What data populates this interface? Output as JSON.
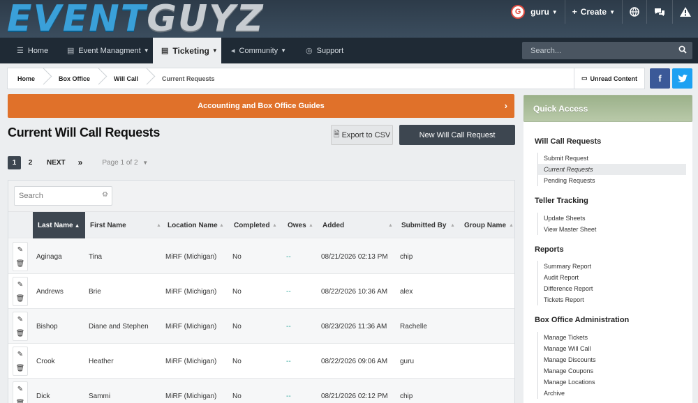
{
  "brand": {
    "logo_part1": "EVENT",
    "logo_part2": "GUYZ"
  },
  "user_bar": {
    "avatar_letter": "G",
    "username": "guru",
    "create_label": "Create"
  },
  "nav": {
    "items": [
      {
        "label": "Home"
      },
      {
        "label": "Event Managment"
      },
      {
        "label": "Ticketing"
      },
      {
        "label": "Community"
      },
      {
        "label": "Support"
      }
    ],
    "search_placeholder": "Search..."
  },
  "breadcrumb": {
    "items": [
      "Home",
      "Box Office",
      "Will Call",
      "Current Requests"
    ],
    "unread_label": "Unread Content"
  },
  "social": {
    "facebook": "f",
    "twitter": "t"
  },
  "main": {
    "banner": "Accounting and Box Office Guides",
    "title": "Current Will Call Requests",
    "export_label": "Export to CSV",
    "new_label": "New Will Call Request",
    "pager": {
      "pages": [
        "1",
        "2"
      ],
      "next": "NEXT",
      "last": "»",
      "page_of": "Page 1 of 2"
    },
    "table": {
      "search_placeholder": "Search",
      "headers": [
        "Last Name",
        "First Name",
        "Location Name",
        "Completed",
        "Owes",
        "Added",
        "Submitted By",
        "Group Name"
      ],
      "rows": [
        [
          "Aginaga",
          "Tina",
          "MiRF (Michigan)",
          "No",
          "--",
          "08/21/2026 02:13 PM",
          "chip",
          ""
        ],
        [
          "Andrews",
          "Brie",
          "MiRF (Michigan)",
          "No",
          "--",
          "08/22/2026 10:36 AM",
          "alex",
          ""
        ],
        [
          "Bishop",
          "Diane and Stephen",
          "MiRF (Michigan)",
          "No",
          "--",
          "08/23/2026 11:36 AM",
          "Rachelle",
          ""
        ],
        [
          "Crook",
          "Heather",
          "MiRF (Michigan)",
          "No",
          "--",
          "08/22/2026 09:06 AM",
          "guru",
          ""
        ],
        [
          "Dick",
          "Sammi",
          "MiRF (Michigan)",
          "No",
          "--",
          "08/21/2026 02:12 PM",
          "chip",
          ""
        ]
      ]
    }
  },
  "sidebar": {
    "title": "Quick Access",
    "sections": [
      {
        "title": "Will Call Requests",
        "items": [
          "Submit Request",
          "Current Requests",
          "Pending Requests"
        ]
      },
      {
        "title": "Teller Tracking",
        "items": [
          "Update Sheets",
          "View Master Sheet"
        ]
      },
      {
        "title": "Reports",
        "items": [
          "Summary Report",
          "Audit Report",
          "Difference Report",
          "Tickets Report"
        ]
      },
      {
        "title": "Box Office Administration",
        "items": [
          "Manage Tickets",
          "Manage Will Call",
          "Manage Discounts",
          "Manage Coupons",
          "Manage Locations",
          "Archive"
        ]
      }
    ]
  },
  "colors": {
    "nav_dark": "#1f2a35",
    "accent_orange": "#e0712a",
    "button_dark": "#3d4650",
    "quick_access_green": "#9bb18a",
    "facebook_blue": "#3b5998",
    "twitter_blue": "#1da1f2"
  }
}
